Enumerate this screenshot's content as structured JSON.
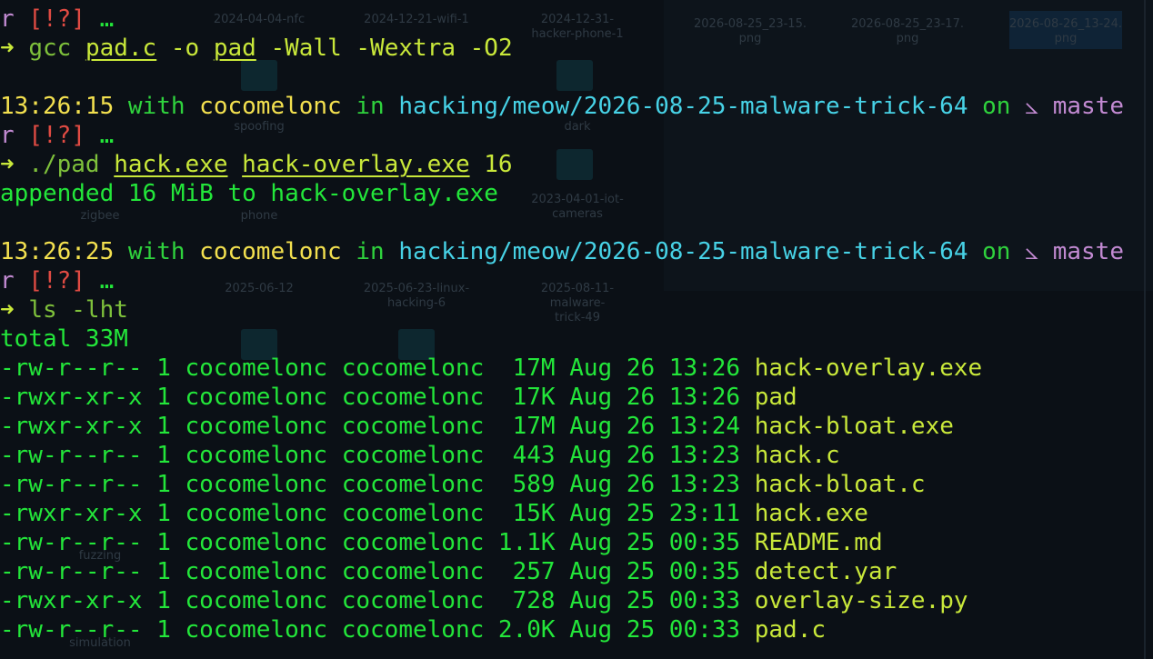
{
  "window": {
    "title": ""
  },
  "background_labels": [
    "2024-04-04-nfc",
    "2024-12-21-wifi-1",
    "2024-12-31-\nhacker-phone-1",
    "2026-08-25_23-15.\npng",
    "2026-08-25_23-17.\npng",
    "2026-08-26_13-24.\npng",
    "spoofing",
    "dark",
    "zigbee",
    "phone",
    "2023-04-01-iot-\ncameras",
    "2025-06-12",
    "2025-06-23-linux-\nhacking-6",
    "2025-08-11-malware-\ntrick-49",
    "fuzzing",
    "simulation"
  ],
  "prompt": {
    "with": "with",
    "user": "cocomelonc",
    "in": "in",
    "path": "hacking/meow/2026-08-25-malware-trick-64",
    "on": "on",
    "branch_icon": "⦣",
    "branch_wrap": "maste",
    "branch_wrap2": "r",
    "status": "[!?]",
    "ellipsis": "…",
    "arrow": "➜"
  },
  "top_fragment": {
    "prefix": "r",
    "status": "[!?]",
    "ellipsis": "…"
  },
  "commands": [
    {
      "cmd": "gcc",
      "args": [
        "pad.c",
        "-o",
        "pad",
        "-Wall",
        "-Wextra",
        "-O2"
      ]
    },
    {
      "cmd": "./pad",
      "args": [
        "hack.exe",
        "hack-overlay.exe",
        "16"
      ]
    },
    {
      "cmd": "ls",
      "args": [
        "-lht"
      ]
    }
  ],
  "outputs": {
    "pad_result": "appended 16 MiB to hack-overlay.exe",
    "ls_total": "total 33M"
  },
  "timestamps": [
    "13:26:15",
    "13:26:25"
  ],
  "ls_rows": [
    {
      "perms": "-rw-r--r--",
      "links": "1",
      "owner": "cocomelonc",
      "group": "cocomelonc",
      "size": "17M",
      "month": "Aug",
      "day": "26",
      "time": "13:26",
      "name": "hack-overlay.exe"
    },
    {
      "perms": "-rwxr-xr-x",
      "links": "1",
      "owner": "cocomelonc",
      "group": "cocomelonc",
      "size": "17K",
      "month": "Aug",
      "day": "26",
      "time": "13:26",
      "name": "pad"
    },
    {
      "perms": "-rwxr-xr-x",
      "links": "1",
      "owner": "cocomelonc",
      "group": "cocomelonc",
      "size": "17M",
      "month": "Aug",
      "day": "26",
      "time": "13:24",
      "name": "hack-bloat.exe"
    },
    {
      "perms": "-rw-r--r--",
      "links": "1",
      "owner": "cocomelonc",
      "group": "cocomelonc",
      "size": "443",
      "month": "Aug",
      "day": "26",
      "time": "13:23",
      "name": "hack.c"
    },
    {
      "perms": "-rw-r--r--",
      "links": "1",
      "owner": "cocomelonc",
      "group": "cocomelonc",
      "size": "589",
      "month": "Aug",
      "day": "26",
      "time": "13:23",
      "name": "hack-bloat.c"
    },
    {
      "perms": "-rwxr-xr-x",
      "links": "1",
      "owner": "cocomelonc",
      "group": "cocomelonc",
      "size": "15K",
      "month": "Aug",
      "day": "25",
      "time": "23:11",
      "name": "hack.exe"
    },
    {
      "perms": "-rw-r--r--",
      "links": "1",
      "owner": "cocomelonc",
      "group": "cocomelonc",
      "size": "1.1K",
      "month": "Aug",
      "day": "25",
      "time": "00:35",
      "name": "README.md"
    },
    {
      "perms": "-rw-r--r--",
      "links": "1",
      "owner": "cocomelonc",
      "group": "cocomelonc",
      "size": "257",
      "month": "Aug",
      "day": "25",
      "time": "00:35",
      "name": "detect.yar"
    },
    {
      "perms": "-rwxr-xr-x",
      "links": "1",
      "owner": "cocomelonc",
      "group": "cocomelonc",
      "size": "728",
      "month": "Aug",
      "day": "25",
      "time": "00:33",
      "name": "overlay-size.py"
    },
    {
      "perms": "-rw-r--r--",
      "links": "1",
      "owner": "cocomelonc",
      "group": "cocomelonc",
      "size": "2.0K",
      "month": "Aug",
      "day": "25",
      "time": "00:33",
      "name": "pad.c"
    }
  ],
  "colors": {
    "background": "#0b1016",
    "green": "#23e63a",
    "yellow": "#f3e04f",
    "cyan": "#47d2e6",
    "purple": "#c28ad2",
    "red": "#e14b43",
    "lime": "#c9e83a"
  }
}
